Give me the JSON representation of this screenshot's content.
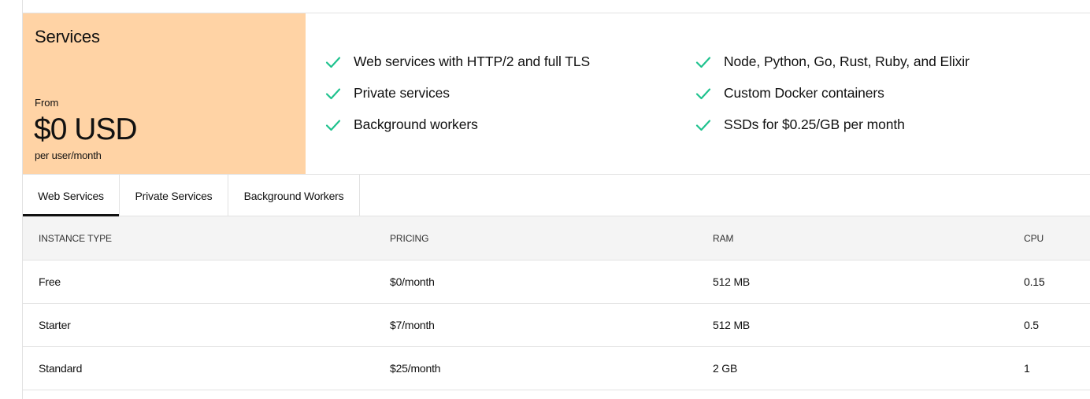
{
  "plan": {
    "title": "Services",
    "from_label": "From",
    "price": "$0 USD",
    "unit": "per user/month"
  },
  "features": {
    "left": [
      "Web services with HTTP/2 and full TLS",
      "Private services",
      "Background workers"
    ],
    "right": [
      "Node, Python, Go, Rust, Ruby, and Elixir",
      "Custom Docker containers",
      "SSDs for $0.25/GB per month"
    ],
    "check_icon": "check-icon",
    "check_color": "#1fc28e"
  },
  "tabs": [
    {
      "label": "Web Services",
      "active": true
    },
    {
      "label": "Private Services",
      "active": false
    },
    {
      "label": "Background Workers",
      "active": false
    }
  ],
  "table": {
    "headers": [
      "INSTANCE TYPE",
      "PRICING",
      "RAM",
      "CPU"
    ],
    "rows": [
      [
        "Free",
        "$0/month",
        "512 MB",
        "0.15"
      ],
      [
        "Starter",
        "$7/month",
        "512 MB",
        "0.5"
      ],
      [
        "Standard",
        "$25/month",
        "2 GB",
        "1"
      ]
    ]
  },
  "colors": {
    "plan_card_bg": "#ffd3a5",
    "table_header_bg": "#f4f4f4",
    "active_tab_underline": "#111111"
  }
}
